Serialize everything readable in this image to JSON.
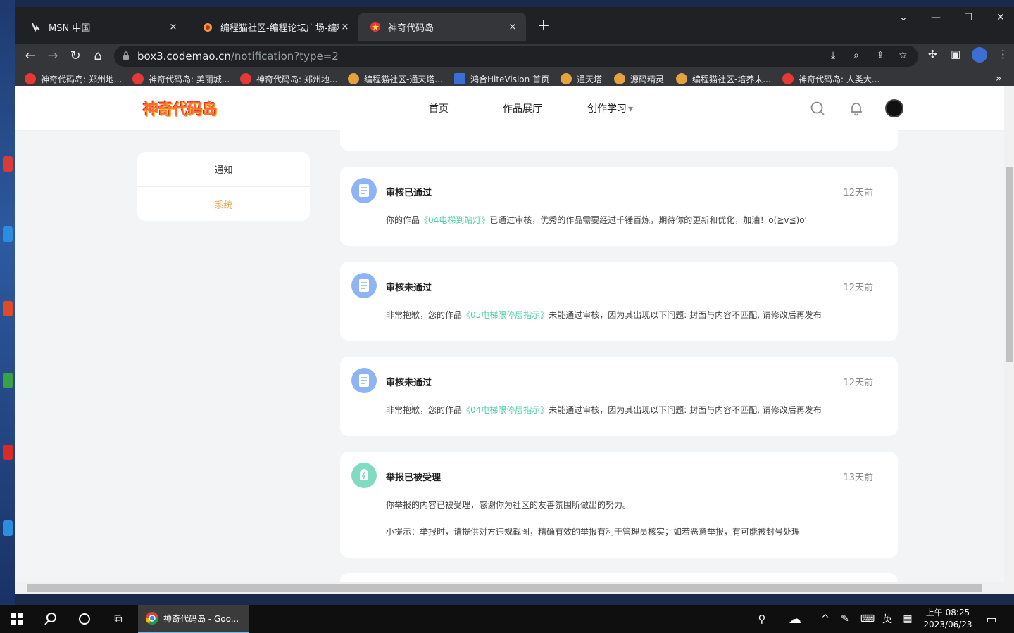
{
  "browser": {
    "tabs": [
      {
        "title": "MSN 中国",
        "close": "×"
      },
      {
        "title": "编程猫社区-编程论坛广场-编程学",
        "close": "×"
      },
      {
        "title": "神奇代码岛",
        "close": "×"
      }
    ],
    "new_tab": "+",
    "url_host": "box3.codemao.cn",
    "url_path": "/notification?type=2",
    "bookmarks": [
      "神奇代码岛: 郑州地...",
      "神奇代码岛: 美丽城...",
      "神奇代码岛: 郑州地...",
      "编程猫社区-通天塔...",
      "鸿合HiteVision 首页",
      "通天塔",
      "源码精灵",
      "编程猫社区-培养未...",
      "神奇代码岛: 人类大..."
    ],
    "bookmarks_overflow": "»"
  },
  "site": {
    "logo_text": "神奇代码岛",
    "nav": [
      "首页",
      "作品展厅",
      "创作学习"
    ],
    "nav_dropdown_caret": "▾"
  },
  "sidebar": {
    "items": [
      {
        "label": "通知",
        "active": false
      },
      {
        "label": "系统",
        "active": true
      }
    ],
    "active_color": "#f0a452"
  },
  "notifications": [
    {
      "type": "review",
      "title": "审核已通过",
      "time": "12天前",
      "body_prefix": "你的作品",
      "work": "《04电梯到站灯》",
      "body_suffix": "已通过审核，优秀的作品需要经过千锤百炼，期待你的更新和优化，加油！o(≧v≦)o'"
    },
    {
      "type": "review",
      "title": "审核未通过",
      "time": "12天前",
      "body_prefix": "非常抱歉，您的作品",
      "work": "《05电梯限停层指示》",
      "body_suffix": "未能通过审核，因为其出现以下问题: 封面与内容不匹配, 请修改后再发布"
    },
    {
      "type": "review",
      "title": "审核未通过",
      "time": "12天前",
      "body_prefix": "非常抱歉，您的作品",
      "work": "《04电梯限停层指示》",
      "body_suffix": "未能通过审核，因为其出现以下问题: 封面与内容不匹配, 请修改后再发布"
    },
    {
      "type": "report",
      "title": "举报已被受理",
      "time": "13天前",
      "line1": "你举报的内容已被受理，感谢你为社区的友善氛围所做出的努力。",
      "line2": "小提示：举报时，请提供对方违规截图，精确有效的举报有利于管理员核实；如若恶意举报，有可能被封号处理"
    }
  ],
  "taskbar": {
    "app_label": "神奇代码岛 - Goo...",
    "ime": "英",
    "time": "上午 08:25",
    "date": "2023/06/23"
  },
  "colors": {
    "link": "#4ccfa5",
    "review_icon": "#8eb4f5",
    "report_icon": "#7fdcc2"
  }
}
